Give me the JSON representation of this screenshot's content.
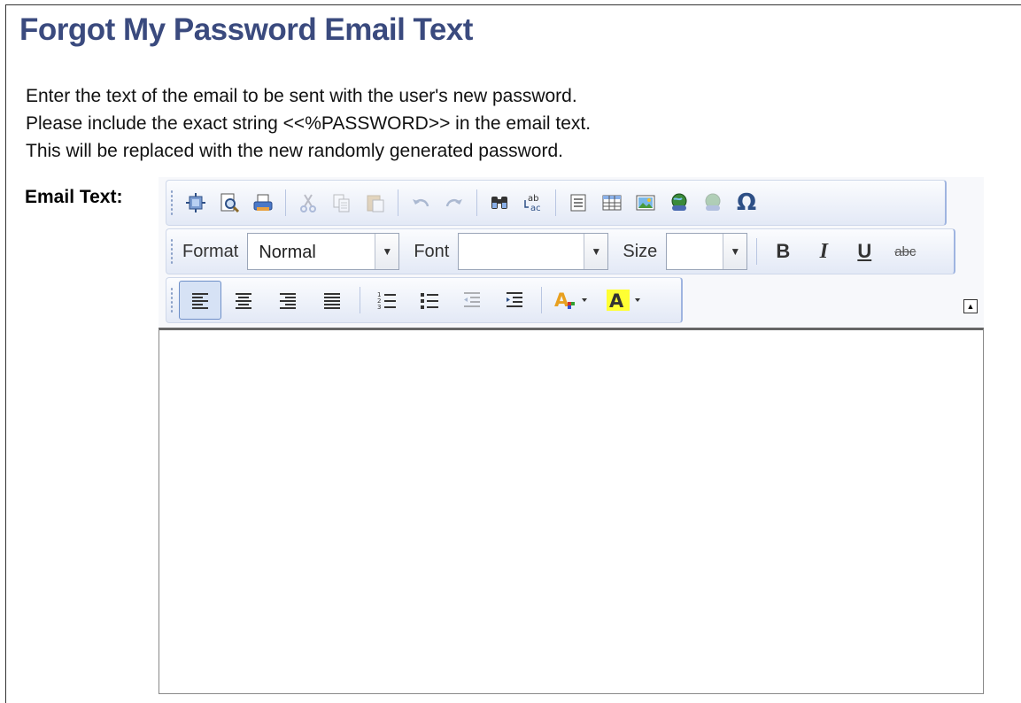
{
  "page": {
    "title": "Forgot My Password Email Text",
    "instructions": [
      "Enter the text of the email to be sent with the user's new password.",
      "Please include the exact string <<%PASSWORD>> in the email text.",
      "This will be replaced with the new randomly generated password."
    ],
    "field_label": "Email Text:"
  },
  "editor": {
    "format_label": "Format",
    "format_value": "Normal",
    "font_label": "Font",
    "font_value": "",
    "size_label": "Size",
    "size_value": "",
    "bold_glyph": "B",
    "italic_glyph": "I",
    "underline_glyph": "U",
    "strike_glyph": "abc",
    "content": "",
    "toolbar_icons": {
      "row1": [
        "source-icon",
        "preview-icon",
        "print-icon",
        "cut-icon",
        "copy-icon",
        "paste-icon",
        "undo-icon",
        "redo-icon",
        "find-icon",
        "replace-icon",
        "horizontal-rule-icon",
        "table-icon",
        "image-icon",
        "link-icon",
        "unlink-icon",
        "special-char-icon"
      ],
      "row3": [
        "align-left-icon",
        "align-center-icon",
        "align-right-icon",
        "justify-icon",
        "numbered-list-icon",
        "bullet-list-icon",
        "outdent-icon",
        "indent-icon",
        "text-color-icon",
        "bg-color-icon"
      ]
    }
  },
  "colors": {
    "title": "#3a4a7e",
    "toolbar_bg": "#e3e9f6",
    "highlight_yellow": "#ffff33"
  }
}
